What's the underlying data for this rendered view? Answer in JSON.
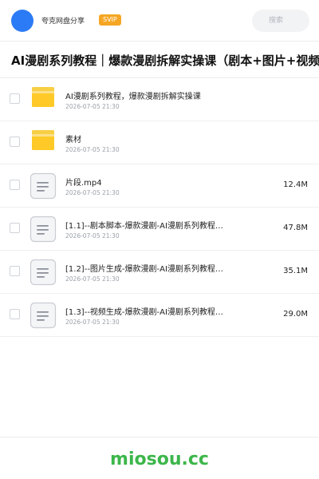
{
  "header": {
    "brand": "夸克网盘分享",
    "badge": "SVIP",
    "search_placeholder": "搜索",
    "colors": {
      "avatar": "#2c7bf6",
      "badge": "#f5a623"
    }
  },
  "share": {
    "title": "AI漫剧系列教程｜爆款漫剧拆解实操课（剧本+图片+视频全"
  },
  "files": [
    {
      "type": "folder",
      "icon": "folder-icon",
      "name": "AI漫剧系列教程，爆款漫剧拆解实操课",
      "date": "2026-07-05 21:30",
      "size": ""
    },
    {
      "type": "folder",
      "icon": "folder-icon",
      "name": "素材",
      "date": "2026-07-05 21:30",
      "size": ""
    },
    {
      "type": "file",
      "icon": "file-icon",
      "name": "片段.mp4",
      "date": "2026-07-05 21:30",
      "size": "12.4M"
    },
    {
      "type": "file",
      "icon": "file-icon",
      "name": "[1.1]--剧本脚本-爆款漫剧-AI漫剧系列教程…",
      "date": "2026-07-05 21:30",
      "size": "47.8M"
    },
    {
      "type": "file",
      "icon": "file-icon",
      "name": "[1.2]--图片生成-爆款漫剧-AI漫剧系列教程…",
      "date": "2026-07-05 21:30",
      "size": "35.1M"
    },
    {
      "type": "file",
      "icon": "file-icon",
      "name": "[1.3]--视频生成-爆款漫剧-AI漫剧系列教程…",
      "date": "2026-07-05 21:30",
      "size": "29.0M"
    }
  ],
  "footer": {
    "watermark": "miosou.cc",
    "color": "#3cb64a"
  }
}
